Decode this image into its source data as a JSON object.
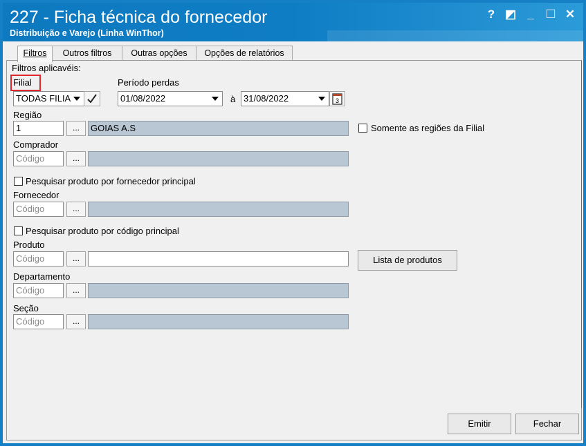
{
  "window": {
    "title": "227 - Ficha técnica do fornecedor",
    "subtitle": "Distribuição e Varejo (Linha WinThor)",
    "help_label": "?",
    "restore_label": "◩",
    "minimize_label": "_",
    "maximize_label": "☐",
    "close_label": "✕"
  },
  "tabs": [
    {
      "label": "Filtros",
      "active": true
    },
    {
      "label": "Outros filtros",
      "active": false
    },
    {
      "label": "Outras opções",
      "active": false
    },
    {
      "label": "Opções de relatórios",
      "active": false
    }
  ],
  "filters": {
    "group_label": "Filtros aplicavéis:",
    "filial": {
      "label": "Filial",
      "value": "TODAS FILIA"
    },
    "periodo": {
      "label": "Período perdas",
      "start": "01/08/2022",
      "separator": "à",
      "end": "31/08/2022"
    },
    "regiao": {
      "label": "Região",
      "code": "1",
      "name": "GOIAS A.S",
      "checkbox_label": "Somente as regiões da Filial"
    },
    "comprador": {
      "label": "Comprador",
      "placeholder": "Código"
    },
    "pesquisar_fornecedor_label": "Pesquisar produto por fornecedor principal",
    "fornecedor": {
      "label": "Fornecedor",
      "placeholder": "Código"
    },
    "pesquisar_codigo_label": "Pesquisar produto por código principal",
    "produto": {
      "label": "Produto",
      "placeholder": "Código",
      "list_button": "Lista de produtos"
    },
    "departamento": {
      "label": "Departamento",
      "placeholder": "Código"
    },
    "secao": {
      "label": "Seção",
      "placeholder": "Código"
    },
    "dots_label": "..."
  },
  "footer": {
    "emitir": "Emitir",
    "fechar": "Fechar"
  },
  "colors": {
    "titlebar": "#0d79c0",
    "highlight": "#e0262a",
    "readonly_field": "#b9c7d4"
  }
}
